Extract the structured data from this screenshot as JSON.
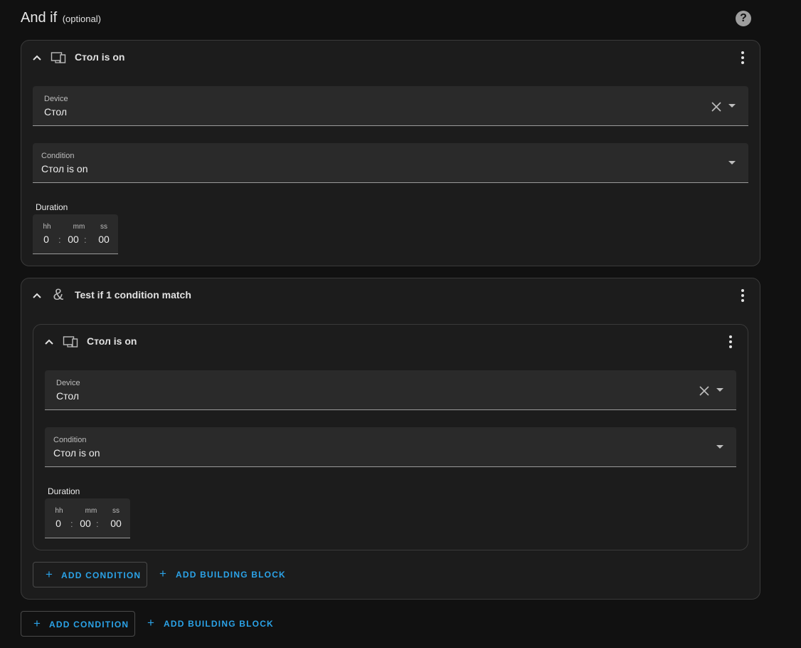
{
  "section": {
    "title": "And if",
    "optional": "(optional)"
  },
  "conditions": [
    {
      "title": "Стол is on",
      "icon": "devices-icon",
      "device_label": "Device",
      "device_value": "Стол",
      "condition_label": "Condition",
      "condition_value": "Стол is on",
      "duration_label": "Duration",
      "duration": {
        "hh_label": "hh",
        "mm_label": "mm",
        "ss_label": "ss",
        "hh": "0",
        "mm": "00",
        "ss": "00"
      }
    },
    {
      "title": "Test if 1 condition match",
      "icon": "ampersand-icon",
      "nested": {
        "title": "Стол is on",
        "icon": "devices-icon",
        "device_label": "Device",
        "device_value": "Стол",
        "condition_label": "Condition",
        "condition_value": "Стол is on",
        "duration_label": "Duration",
        "duration": {
          "hh_label": "hh",
          "mm_label": "mm",
          "ss_label": "ss",
          "hh": "0",
          "mm": "00",
          "ss": "00"
        }
      },
      "add_condition_label": "ADD CONDITION",
      "add_building_block_label": "ADD BUILDING BLOCK"
    }
  ],
  "footer": {
    "add_condition_label": "ADD CONDITION",
    "add_building_block_label": "ADD BUILDING BLOCK"
  },
  "colors": {
    "accent": "#2ba3e8",
    "background": "#111111",
    "card": "#1c1c1c",
    "field": "#2a2a2a"
  }
}
